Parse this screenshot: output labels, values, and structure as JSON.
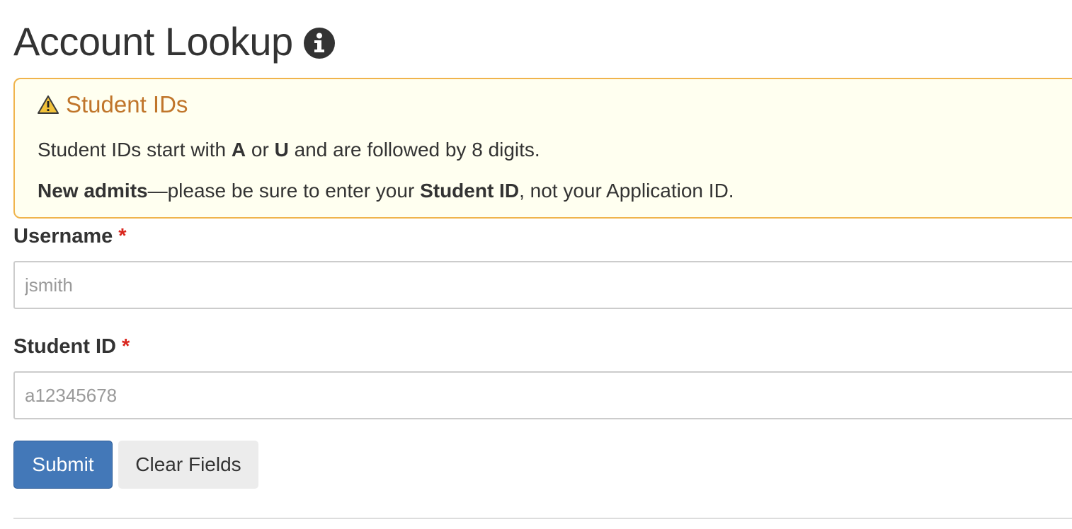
{
  "page": {
    "title": "Account Lookup",
    "title_icon": "info-circle-icon"
  },
  "alert": {
    "icon": "warning-triangle-icon",
    "title": "Student IDs",
    "line1": {
      "part1": "Student IDs start with ",
      "bold1": "A",
      "part2": " or ",
      "bold2": "U",
      "part3": " and are followed by 8 digits."
    },
    "line2": {
      "bold1": "New admits",
      "part1": "—please be sure to enter your ",
      "bold2": "Student ID",
      "part2": ", not your Application ID."
    },
    "colors": {
      "background": "#fffff0",
      "border": "#f0b44c",
      "title": "#c0752a"
    }
  },
  "form": {
    "username": {
      "label": "Username",
      "required_mark": "*",
      "placeholder": "jsmith",
      "value": ""
    },
    "student_id": {
      "label": "Student ID",
      "required_mark": "*",
      "placeholder": "a12345678",
      "value": ""
    },
    "buttons": {
      "submit_label": "Submit",
      "clear_label": "Clear Fields"
    },
    "colors": {
      "submit": "#4378b8",
      "required": "#d9251d"
    }
  }
}
